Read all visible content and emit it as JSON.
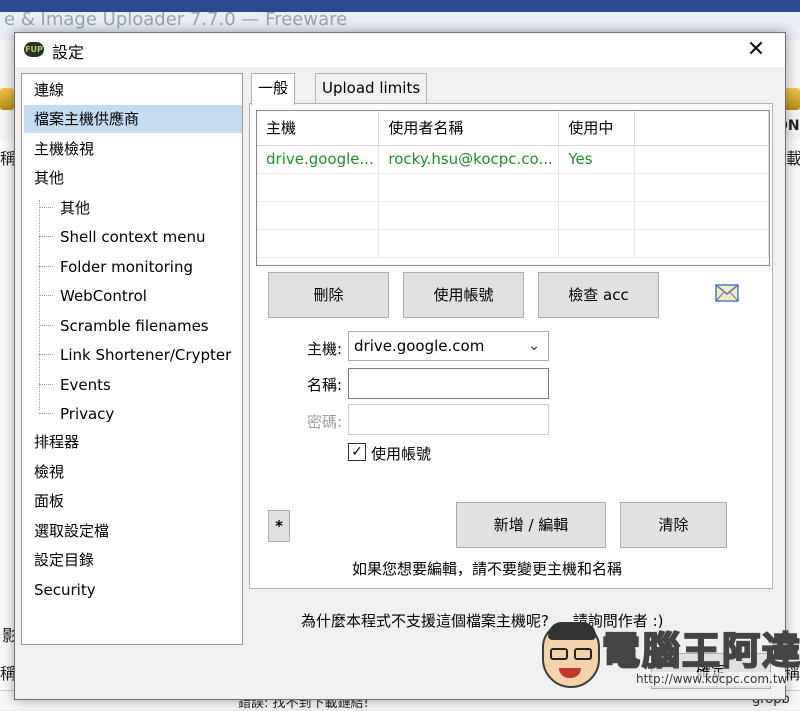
{
  "background": {
    "app_title": "e & Image Uploader 7.7.0 — Freeware",
    "status_error": "錯誤: 找不到下載鏈結!",
    "status_right": "gropb",
    "left_chars": [
      "稱",
      "影",
      "稱"
    ],
    "right_chars": [
      "載",
      "ON",
      "稱"
    ]
  },
  "dialog": {
    "title": "設定",
    "icon_text": "FUP",
    "close_glyph": "✕"
  },
  "tree": {
    "items": [
      {
        "label": "連線",
        "level": 0
      },
      {
        "label": "檔案主機供應商",
        "level": 0,
        "selected": true
      },
      {
        "label": "主機檢視",
        "level": 0
      },
      {
        "label": "其他",
        "level": 0
      },
      {
        "label": "其他",
        "level": 1
      },
      {
        "label": "Shell context menu",
        "level": 1
      },
      {
        "label": "Folder monitoring",
        "level": 1
      },
      {
        "label": "WebControl",
        "level": 1
      },
      {
        "label": "Scramble filenames",
        "level": 1
      },
      {
        "label": "Link Shortener/Crypter",
        "level": 1
      },
      {
        "label": "Events",
        "level": 1
      },
      {
        "label": "Privacy",
        "level": 1
      },
      {
        "label": "排程器",
        "level": 0
      },
      {
        "label": "檢視",
        "level": 0
      },
      {
        "label": "面板",
        "level": 0
      },
      {
        "label": "選取設定檔",
        "level": 0
      },
      {
        "label": "設定目錄",
        "level": 0
      },
      {
        "label": "Security",
        "level": 0
      }
    ]
  },
  "tabs": [
    {
      "label": "一般",
      "active": true
    },
    {
      "label": "Upload limits",
      "active": false
    }
  ],
  "accounts_table": {
    "columns": [
      "主機",
      "使用者名稱",
      "使用中"
    ],
    "rows": [
      [
        "drive.google...",
        "rocky.hsu@kocpc.co...",
        "Yes"
      ]
    ]
  },
  "buttons": {
    "delete": "刪除",
    "use_account": "使用帳號",
    "check_account": "檢查 acc",
    "star": "*",
    "add_edit": "新增 / 編輯",
    "clear": "清除",
    "ok": "確定"
  },
  "form": {
    "host_label": "主機:",
    "host_value": "drive.google.com",
    "name_label": "名稱:",
    "name_value": "",
    "password_label": "密碼:",
    "password_value": "",
    "use_account_checkbox": "使用帳號",
    "use_account_checked": true
  },
  "notes": {
    "edit_hint": "如果您想要編輯，請不要變更主機和名稱",
    "unsupported_hint": "為什麼本程式不支援這個檔案主機呢? ... 請詢問作者 :)"
  },
  "watermark": {
    "text": "電腦王阿達",
    "url": "http://www.kocpc.com.tw"
  },
  "colors": {
    "selection": "#c4dcf3",
    "table_data": "#1f8f2a",
    "button_face": "#e1e1e1"
  }
}
